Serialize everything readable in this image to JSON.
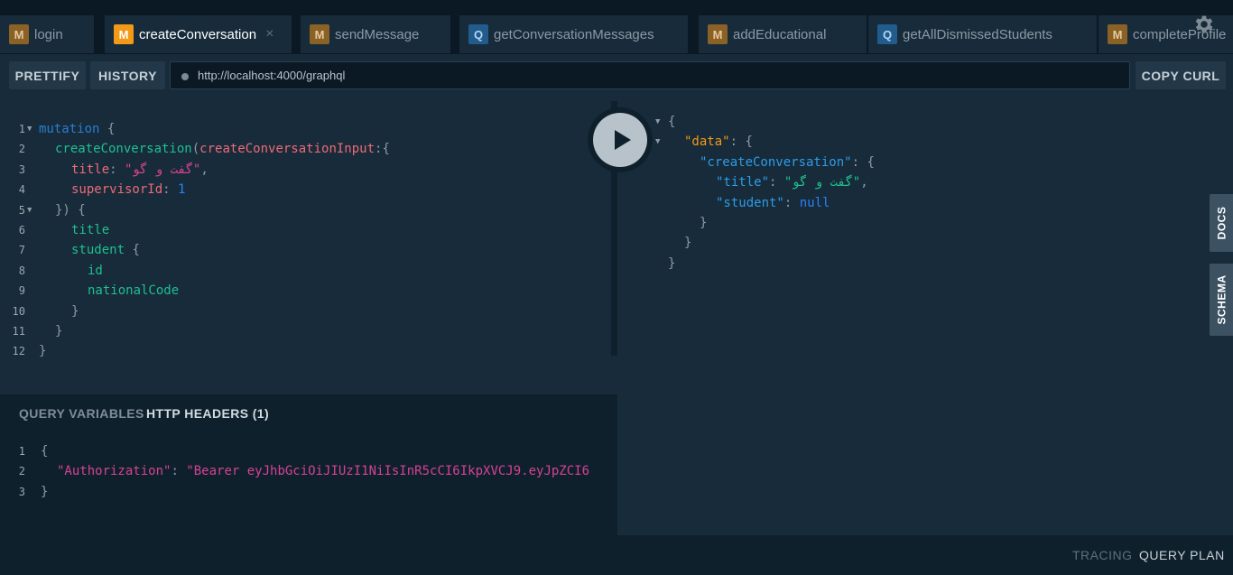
{
  "tabs": [
    {
      "type": "M",
      "label": "login"
    },
    {
      "type": "M",
      "label": "createConversation",
      "active": true
    },
    {
      "type": "M",
      "label": "sendMessage"
    },
    {
      "type": "Q",
      "label": "getConversationMessages"
    },
    {
      "type": "M",
      "label": "addEducational"
    },
    {
      "type": "Q",
      "label": "getAllDismissedStudents"
    },
    {
      "type": "M",
      "label": "completeProfile"
    }
  ],
  "tab_close_glyph": "×",
  "toolbar": {
    "prettify": "PRETTIFY",
    "history": "HISTORY",
    "url": "http://localhost:4000/graphql",
    "copy_curl": "COPY CURL"
  },
  "query_editor": {
    "line_numbers": [
      "1",
      "2",
      "3",
      "4",
      "5",
      "6",
      "7",
      "8",
      "9",
      "10",
      "11",
      "12"
    ],
    "tokens": {
      "mutation": "mutation",
      "open_brace": "{",
      "op": "createConversation",
      "paren_open": "(",
      "input_arg": "createConversationInput",
      "colon_brace": ":{",
      "title_key": "title",
      "colon": ":",
      "title_val": "\"گفت و گو\"",
      "comma": ",",
      "supervisor_key": "supervisorId",
      "supervisor_val": "1",
      "close_args": "}) {",
      "field_title": "title",
      "field_student": "student",
      "field_id": "id",
      "field_national": "nationalCode",
      "close_brace": "}"
    }
  },
  "result": {
    "open": "{",
    "data_key": "\"data\"",
    "create_key": "\"createConversation\"",
    "title_key": "\"title\"",
    "title_val": "\"گفت و گو\"",
    "student_key": "\"student\"",
    "student_val": "null",
    "colon": ": ",
    "comma": ",",
    "brace_open": "{",
    "close": "}"
  },
  "vars_panel": {
    "tab_variables": "QUERY VARIABLES",
    "tab_headers": "HTTP HEADERS (1)",
    "line_numbers": [
      "1",
      "2",
      "3"
    ],
    "open": "{",
    "header_key": "\"Authorization\"",
    "colon": ": ",
    "header_val": "\"Bearer eyJhbGciOiJIUzI1NiIsInR5cCI6IkpXVCJ9.eyJpZCI6",
    "close": "}"
  },
  "side_tabs": {
    "docs": "DOCS",
    "schema": "SCHEMA"
  },
  "bottom": {
    "tracing": "TRACING",
    "query_plan": "QUERY PLAN"
  },
  "icons": {
    "settings": "gear-icon",
    "run": "play-icon"
  },
  "colors": {
    "accent": "#f29a17",
    "mutation_badge": "#8a6226",
    "query_badge": "#215c8d"
  }
}
